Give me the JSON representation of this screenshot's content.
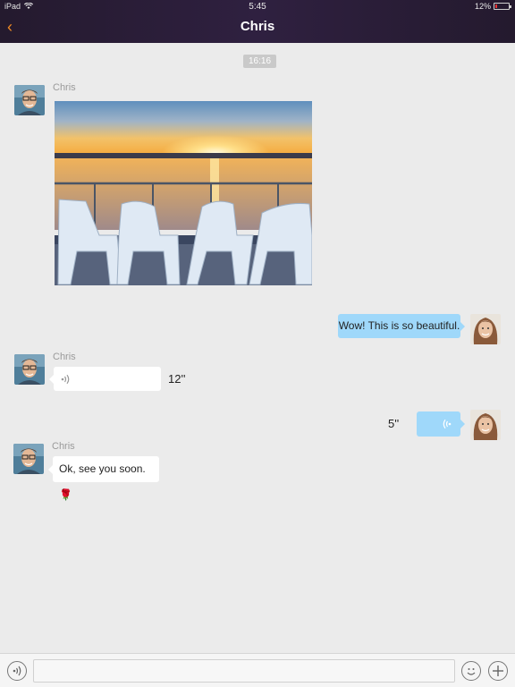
{
  "status_bar": {
    "device": "iPad",
    "time": "5:45",
    "battery": "12%",
    "battery_level": 0.12,
    "wifi_icon": "wifi-icon"
  },
  "header": {
    "back_icon": "chevron-left-icon",
    "back_glyph": "‹",
    "title": "Chris"
  },
  "timestamp": "16:16",
  "messages": [
    {
      "sender": "Chris",
      "type": "image",
      "image": "sunset-chairs-photo"
    },
    {
      "sender": "me",
      "type": "text",
      "text": "Wow! This is so beautiful."
    },
    {
      "sender": "Chris",
      "type": "voice",
      "duration": "12''"
    },
    {
      "sender": "me",
      "type": "voice",
      "duration": "5''"
    },
    {
      "sender": "Chris",
      "type": "text",
      "text": "Ok, see you soon. 🌹"
    }
  ],
  "input_bar": {
    "voice_icon": "voice-icon",
    "emoji_icon": "smiley-icon",
    "add_icon": "plus-icon",
    "placeholder": ""
  },
  "colors": {
    "accent": "#f08a24",
    "outgoing_bubble": "#9fd8fa",
    "incoming_bubble": "#ffffff",
    "background": "#ebebeb"
  }
}
